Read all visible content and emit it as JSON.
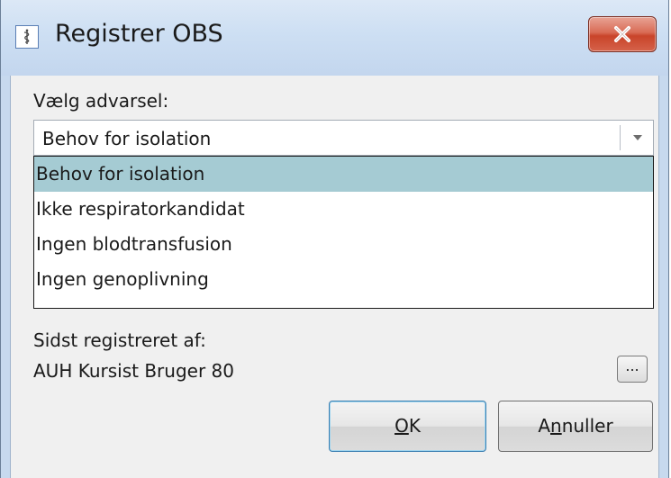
{
  "window": {
    "title": "Registrer OBS",
    "close_icon": "close-icon"
  },
  "form": {
    "warning_label": "Vælg advarsel:",
    "selected_warning": "Behov for isolation",
    "options": [
      "Behov for isolation",
      "Ikke respiratorkandidat",
      "Ingen blodtransfusion",
      "Ingen genoplivning"
    ],
    "last_registered_label": "Sidst registreret af:",
    "last_registered_by": "AUH Kursist Bruger 80",
    "ellipsis_label": "..."
  },
  "buttons": {
    "ok_label_mnemonic": "O",
    "ok_label_rest": "K",
    "cancel_label_pre": "A",
    "cancel_label_mnemonic": "n",
    "cancel_label_rest": "nuller"
  },
  "colors": {
    "selected_item_bg": "#a5cbd3",
    "close_button": "#c9442a"
  }
}
